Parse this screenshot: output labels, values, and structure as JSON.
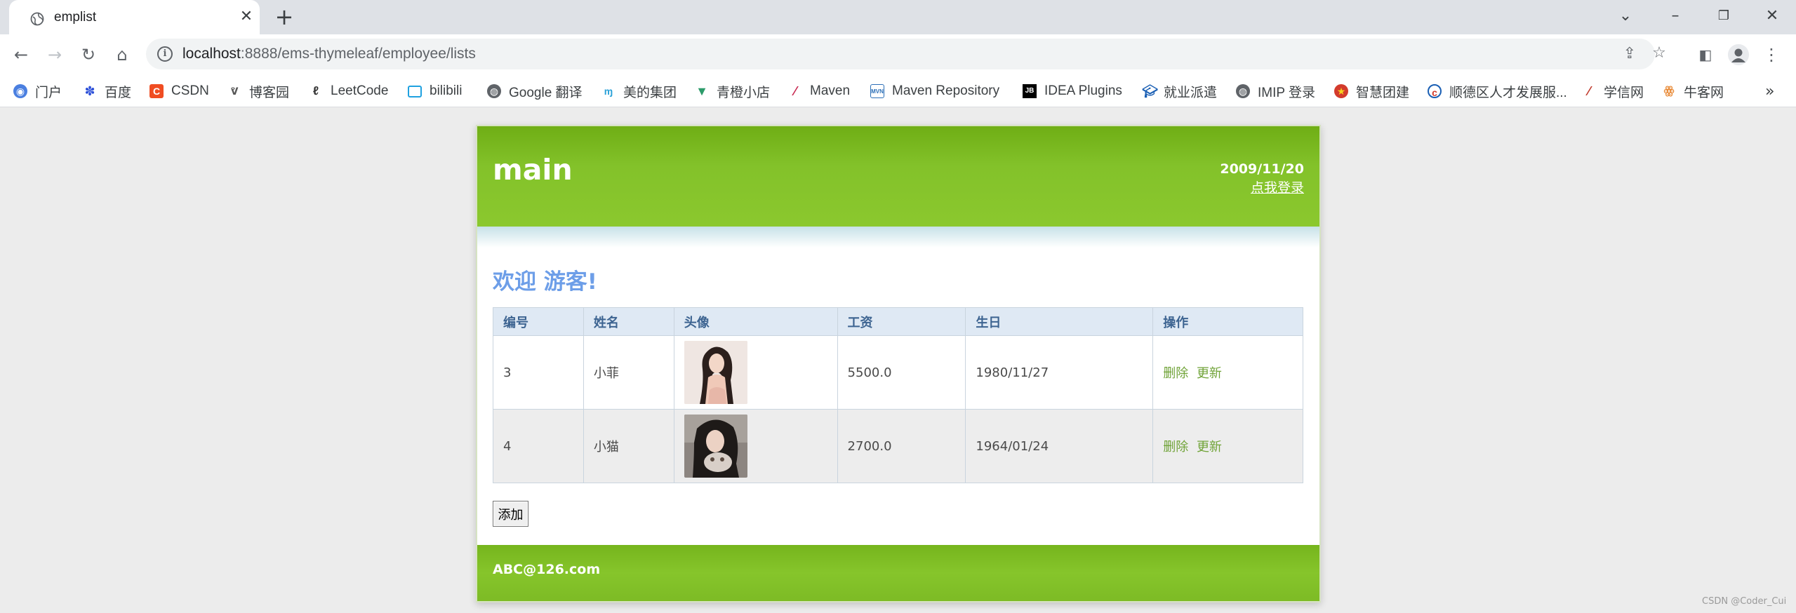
{
  "browser": {
    "tab_title": "emplist",
    "url_host": "localhost",
    "url_rest": ":8888/ems-thymeleaf/employee/lists",
    "bookmarks": [
      {
        "label": "门户",
        "icon": "portal-icon",
        "color": "#4a7fe0"
      },
      {
        "label": "百度",
        "icon": "baidu-paw-icon",
        "color": "#2f52d9"
      },
      {
        "label": "CSDN",
        "icon": "csdn-icon",
        "color": "#f04d22"
      },
      {
        "label": "博客园",
        "icon": "cnblogs-icon",
        "color": "#555555"
      },
      {
        "label": "LeetCode",
        "icon": "leetcode-icon",
        "color": "#333333"
      },
      {
        "label": "bilibili",
        "icon": "bilibili-tv-icon",
        "color": "#1fa1e0"
      },
      {
        "label": "Google 翻译",
        "icon": "globe-icon",
        "color": "#5f6368"
      },
      {
        "label": "美的集团",
        "icon": "midea-icon",
        "color": "#2aa1d8"
      },
      {
        "label": "青橙小店",
        "icon": "vue-icon",
        "color": "#2c9b6a"
      },
      {
        "label": "Maven",
        "icon": "maven-feather-icon",
        "color": "#c7254e"
      },
      {
        "label": "Maven Repository",
        "icon": "mvn-icon",
        "color": "#2c6fb7"
      },
      {
        "label": "IDEA Plugins",
        "icon": "jetbrains-icon",
        "color": "#000000"
      },
      {
        "label": "就业派遣",
        "icon": "graduation-cap-icon",
        "color": "#1a5fb4"
      },
      {
        "label": "IMIP 登录",
        "icon": "globe-icon",
        "color": "#5f6368"
      },
      {
        "label": "智慧团建",
        "icon": "league-badge-icon",
        "color": "#d33b2c"
      },
      {
        "label": "顺德区人才发展服...",
        "icon": "shunde-icon",
        "color": "#d33b2c"
      },
      {
        "label": "学信网",
        "icon": "chsi-icon",
        "color": "#c0392b"
      },
      {
        "label": "牛客网",
        "icon": "nowcoder-icon",
        "color": "#e67e22"
      }
    ]
  },
  "page": {
    "brand": "main",
    "date": "2009/11/20",
    "login_link": "点我登录",
    "welcome": "欢迎 游客!",
    "table": {
      "headers": [
        "编号",
        "姓名",
        "头像",
        "工资",
        "生日",
        "操作"
      ],
      "rows": [
        {
          "id": "3",
          "name": "小菲",
          "salary": "5500.0",
          "birthday": "1980/11/27",
          "delete": "删除",
          "update": "更新"
        },
        {
          "id": "4",
          "name": "小猫",
          "salary": "2700.0",
          "birthday": "1964/01/24",
          "delete": "删除",
          "update": "更新"
        }
      ]
    },
    "add_button": "添加",
    "footer": "ABC@126.com"
  },
  "watermark": "CSDN @Coder_Cui",
  "colors": {
    "header_green": "#83c22a",
    "welcome_blue": "#6d9ee8",
    "link_green": "#70a338",
    "table_header_bg": "#dfe9f4"
  }
}
